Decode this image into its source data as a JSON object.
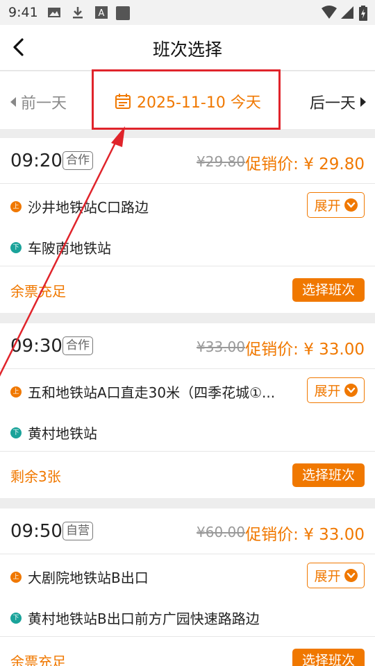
{
  "status_bar": {
    "time": "9:41",
    "left_icons": [
      "image-icon",
      "download-icon",
      "font-a-icon",
      "square-app-icon"
    ],
    "right_icons": [
      "wifi-icon",
      "signal-icon",
      "battery-icon"
    ]
  },
  "nav": {
    "back_icon": "back-chevron-icon",
    "title": "班次选择"
  },
  "date_bar": {
    "prev_label": "前一天",
    "current_date": "2025-11-10 今天",
    "next_label": "后一天",
    "calendar_icon": "calendar-icon"
  },
  "colors": {
    "accent": "#f07800",
    "highlight": "#e0242b",
    "down_stop": "#1aa39a"
  },
  "trips": [
    {
      "time": "09:20",
      "tag": "合作",
      "original_price": "¥29.80",
      "promo_price": "促销价: ¥ 29.80",
      "up_marker": "上",
      "up_stop": "沙井地铁站C口路边",
      "down_marker": "下",
      "down_stop": "车陂南地铁站",
      "expand_label": "展开",
      "remaining": "余票充足",
      "select_label": "选择班次"
    },
    {
      "time": "09:30",
      "tag": "合作",
      "original_price": "¥33.00",
      "promo_price": "促销价: ¥ 33.00",
      "up_marker": "上",
      "up_stop": "五和地铁站A口直走30米（四季花城①...",
      "down_marker": "下",
      "down_stop": "黄村地铁站",
      "expand_label": "展开",
      "remaining": "剩余3张",
      "select_label": "选择班次"
    },
    {
      "time": "09:50",
      "tag": "自营",
      "original_price": "¥60.00",
      "promo_price": "促销价: ¥ 33.00",
      "up_marker": "上",
      "up_stop": "大剧院地铁站B出口",
      "down_marker": "下",
      "down_stop": "黄村地铁站B出口前方广园快速路路边",
      "expand_label": "展开",
      "remaining": "余票充足",
      "select_label": "选择班次"
    }
  ]
}
